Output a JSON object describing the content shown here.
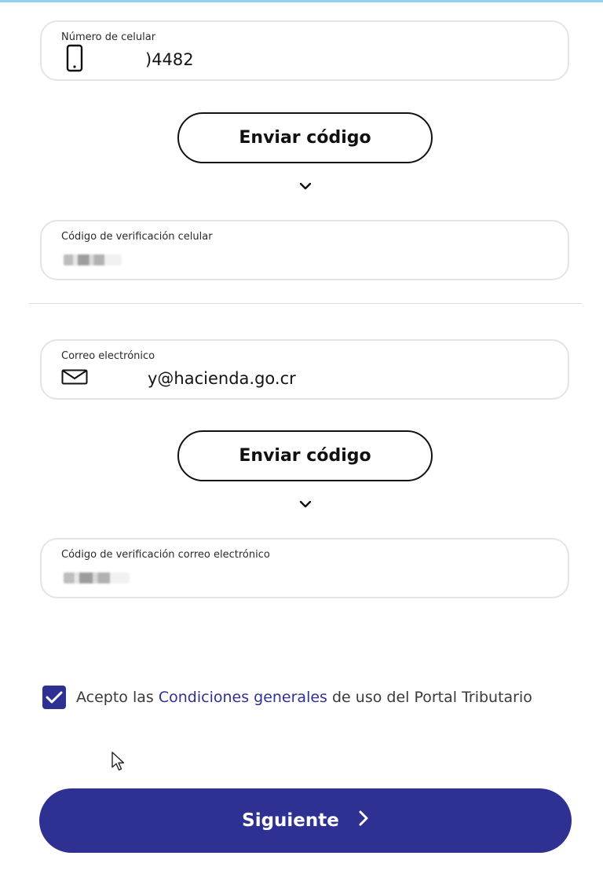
{
  "phone": {
    "label": "Número de celular",
    "value": ")4482",
    "icon": "mobile-phone-icon"
  },
  "phone_send_button": {
    "label": "Enviar código"
  },
  "phone_code": {
    "label": "Código de verificación celular",
    "value_masked": "••••••"
  },
  "email": {
    "label": "Correo electrónico",
    "value": "y@hacienda.go.cr",
    "icon": "envelope-icon"
  },
  "email_send_button": {
    "label": "Enviar código"
  },
  "email_code": {
    "label": "Código de verificación correo electrónico",
    "value_masked": "••••••"
  },
  "terms": {
    "checked": true,
    "prefix": "Acepto las ",
    "link": "Condiciones generales",
    "suffix": " de uso del Portal Tributario"
  },
  "next_button": {
    "label": "Siguiente"
  },
  "colors": {
    "primary": "#2e3191",
    "field_border": "#e4e4e8",
    "top_accent": "#8fd3f0"
  }
}
